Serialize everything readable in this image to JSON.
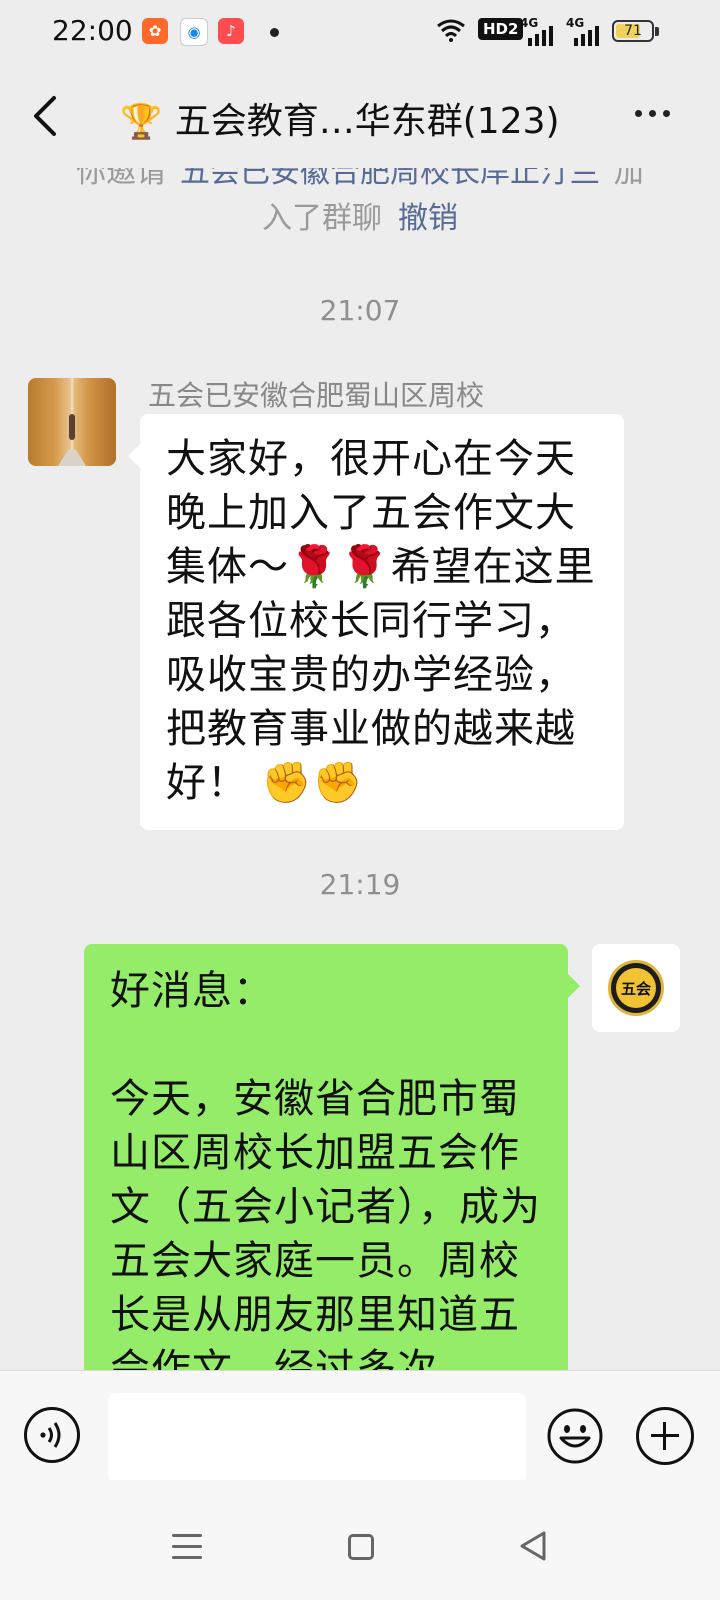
{
  "status_bar": {
    "time": "22:00",
    "apps": [
      {
        "icon": "kuaishou-icon",
        "color": "#ff6a2b"
      },
      {
        "icon": "browser-icon",
        "color": "#1e88e5"
      },
      {
        "icon": "music-icon",
        "color": "#ff4d4f"
      }
    ],
    "hd_label": "HD2",
    "signal_1": "4G",
    "signal_2": "4G",
    "battery": "71",
    "battery_level": 0.71
  },
  "header": {
    "trophy": "🏆",
    "title": "五会教育…华东群(123)"
  },
  "chat": {
    "system_notice": {
      "prefix": "你邀请\"",
      "invitee": "五会已安徽合肥周校长岸止汀兰",
      "suffix": "\"加入了群聊",
      "revoke": "撤销"
    },
    "timestamp_1": "21:07",
    "message_1": {
      "sender": "五会已安徽合肥蜀山区周校",
      "text": "大家好，很开心在今天晚上加入了五会作文大集体～🌹🌹希望在这里跟各位校长同行学习，吸收宝贵的办学经验，把教育事业做的越来越好！ ✊✊"
    },
    "timestamp_2": "21:19",
    "message_2": {
      "text": "好消息：\n\n今天，安徽省合肥市蜀山区周校长加盟五会作文（五会小记者），成为五会大家庭一员。周校长是从朋友那里知道五会作文，经过多次",
      "avatar_logo_text": "五会"
    }
  },
  "input_bar": {
    "placeholder": ""
  }
}
